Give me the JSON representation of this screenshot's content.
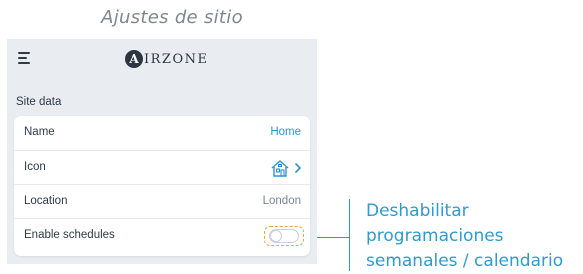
{
  "caption": "Ajustes de sitio",
  "app": {
    "logo_mark": "A",
    "logo_text": "IRZONE"
  },
  "section_title": "Site data",
  "rows": [
    {
      "label": "Name",
      "value": "Home"
    },
    {
      "label": "Icon",
      "value_icon": "house-icon"
    },
    {
      "label": "Location",
      "value": "London"
    },
    {
      "label": "Enable schedules",
      "toggle_on": false
    }
  ],
  "annotation": "Deshabilitar programaciones semanales / calendario",
  "colors": {
    "accent": "#2f94d4",
    "callout": "#2c9bd1",
    "highlight": "#f0a43a",
    "background": "#e9edf2"
  }
}
